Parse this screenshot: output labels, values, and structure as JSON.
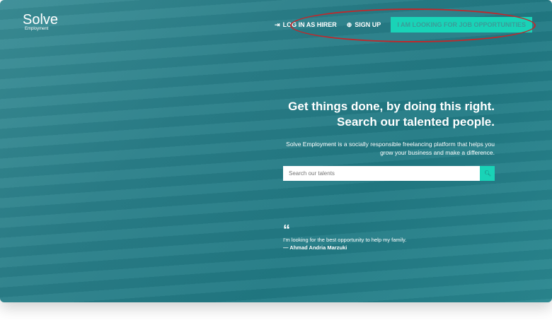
{
  "logo": {
    "name": "Solve",
    "sub": "Employment"
  },
  "nav": {
    "login": "LOG IN AS HIRER",
    "signup": "SIGN UP",
    "cta": "I AM LOOKING FOR JOB OPPORTUNITIES"
  },
  "hero": {
    "line1": "Get things done, by doing this right.",
    "line2": "Search our talented people.",
    "desc1": "Solve Employment is a socially responsible freelancing platform that helps you",
    "desc2": "grow your business and make a difference."
  },
  "search": {
    "placeholder": "Search our talents"
  },
  "quote": {
    "mark": "“",
    "text": "I'm looking for the best opportunity to help my family.",
    "author": "— Ahmad Andria Marzuki"
  },
  "colors": {
    "accent": "#19d3b7",
    "annotation": "#c0282b"
  }
}
